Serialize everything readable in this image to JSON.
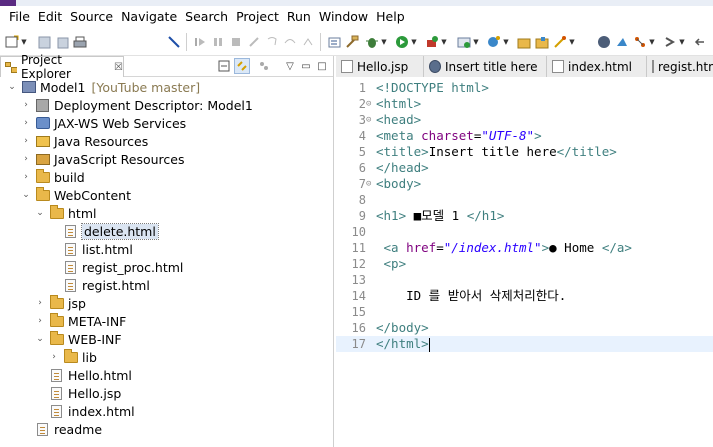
{
  "menu": [
    "File",
    "Edit",
    "Source",
    "Navigate",
    "Search",
    "Project",
    "Run",
    "Window",
    "Help"
  ],
  "explorer": {
    "tab_label": "Project Explorer",
    "tab_close": "☒",
    "tree": [
      {
        "label": "Model1",
        "decoration": "[YouTube master]",
        "level": 0,
        "twisty": "⌄",
        "icon": "project-icon"
      },
      {
        "label": "Deployment Descriptor: Model1",
        "level": 1,
        "twisty": "›",
        "icon": "deployment-descriptor-icon"
      },
      {
        "label": "JAX-WS Web Services",
        "level": 1,
        "twisty": "›",
        "icon": "web-services-icon"
      },
      {
        "label": "Java Resources",
        "level": 1,
        "twisty": "›",
        "icon": "java-resources-icon"
      },
      {
        "label": "JavaScript Resources",
        "level": 1,
        "twisty": "›",
        "icon": "javascript-resources-icon"
      },
      {
        "label": "build",
        "level": 1,
        "twisty": "›",
        "icon": "folder-icon"
      },
      {
        "label": "WebContent",
        "level": 1,
        "twisty": "⌄",
        "icon": "folder-icon"
      },
      {
        "label": "html",
        "level": 2,
        "twisty": "⌄",
        "icon": "folder-icon"
      },
      {
        "label": "delete.html",
        "level": 3,
        "twisty": "",
        "icon": "html-file-icon",
        "selected": true
      },
      {
        "label": "list.html",
        "level": 3,
        "twisty": "",
        "icon": "html-file-icon"
      },
      {
        "label": "regist_proc.html",
        "level": 3,
        "twisty": "",
        "icon": "html-file-icon"
      },
      {
        "label": "regist.html",
        "level": 3,
        "twisty": "",
        "icon": "html-file-icon"
      },
      {
        "label": "jsp",
        "level": 2,
        "twisty": "›",
        "icon": "folder-icon"
      },
      {
        "label": "META-INF",
        "level": 2,
        "twisty": "›",
        "icon": "folder-icon"
      },
      {
        "label": "WEB-INF",
        "level": 2,
        "twisty": "⌄",
        "icon": "folder-icon"
      },
      {
        "label": "lib",
        "level": 3,
        "twisty": "›",
        "icon": "folder-icon"
      },
      {
        "label": "Hello.html",
        "level": 2,
        "twisty": "",
        "icon": "html-file-icon"
      },
      {
        "label": "Hello.jsp",
        "level": 2,
        "twisty": "",
        "icon": "jsp-file-icon"
      },
      {
        "label": "index.html",
        "level": 2,
        "twisty": "",
        "icon": "html-file-icon"
      },
      {
        "label": "readme",
        "level": 1,
        "twisty": "",
        "icon": "text-file-icon"
      }
    ]
  },
  "editor": {
    "tabs": [
      {
        "label": "Hello.jsp",
        "icon": "jsp-file-icon"
      },
      {
        "label": "Insert title here",
        "icon": "browser-icon"
      },
      {
        "label": "index.html",
        "icon": "html-file-icon"
      },
      {
        "label": "regist.htm",
        "icon": "html-file-icon"
      }
    ],
    "lines": [
      {
        "n": "1",
        "fold": "",
        "parts": [
          [
            "tag",
            "<!DOCTYPE html>"
          ]
        ]
      },
      {
        "n": "2",
        "fold": "⊝",
        "parts": [
          [
            "tag",
            "<html>"
          ]
        ]
      },
      {
        "n": "3",
        "fold": "⊝",
        "parts": [
          [
            "tag",
            "<head>"
          ]
        ]
      },
      {
        "n": "4",
        "fold": "",
        "parts": [
          [
            "tag",
            "<meta "
          ],
          [
            "attr",
            "charset"
          ],
          [
            "txt",
            "="
          ],
          [
            "str",
            "\"UTF-8\""
          ],
          [
            "tag",
            ">"
          ]
        ]
      },
      {
        "n": "5",
        "fold": "",
        "parts": [
          [
            "tag",
            "<title>"
          ],
          [
            "txt",
            "Insert title here"
          ],
          [
            "tag",
            "</title>"
          ]
        ]
      },
      {
        "n": "6",
        "fold": "",
        "parts": [
          [
            "tag",
            "</head>"
          ]
        ]
      },
      {
        "n": "7",
        "fold": "⊝",
        "parts": [
          [
            "tag",
            "<body>"
          ]
        ]
      },
      {
        "n": "8",
        "fold": "",
        "parts": []
      },
      {
        "n": "9",
        "fold": "",
        "parts": [
          [
            "tag",
            "<h1>"
          ],
          [
            "txt",
            " ■모델 1 "
          ],
          [
            "tag",
            "</h1>"
          ]
        ]
      },
      {
        "n": "10",
        "fold": "",
        "parts": []
      },
      {
        "n": "11",
        "fold": "",
        "parts": [
          [
            "txt",
            " "
          ],
          [
            "tag",
            "<a "
          ],
          [
            "attr",
            "href"
          ],
          [
            "txt",
            "="
          ],
          [
            "str",
            "\"/index.html\""
          ],
          [
            "tag",
            ">"
          ],
          [
            "txt",
            "● Home "
          ],
          [
            "tag",
            "</a>"
          ]
        ]
      },
      {
        "n": "12",
        "fold": "",
        "parts": [
          [
            "txt",
            " "
          ],
          [
            "tag",
            "<p>"
          ]
        ]
      },
      {
        "n": "13",
        "fold": "",
        "parts": []
      },
      {
        "n": "14",
        "fold": "",
        "parts": [
          [
            "txt",
            "    ID 를 받아서 삭제처리한다."
          ]
        ]
      },
      {
        "n": "15",
        "fold": "",
        "parts": []
      },
      {
        "n": "16",
        "fold": "",
        "parts": [
          [
            "tag",
            "</body>"
          ]
        ]
      },
      {
        "n": "17",
        "fold": "",
        "parts": [
          [
            "tag",
            "</html>"
          ]
        ],
        "current": true
      }
    ]
  },
  "colors": {
    "tag": "#3f7f7f",
    "attr": "#7f007f",
    "string": "#2a00ff",
    "selection": "#dbe5f2",
    "current_line": "#e8f2fe"
  }
}
